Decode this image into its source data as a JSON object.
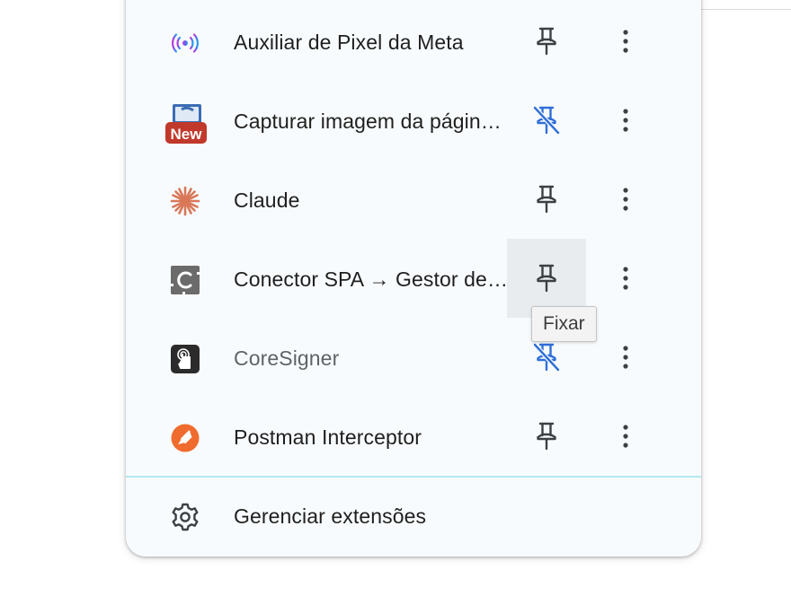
{
  "extensions": [
    {
      "name": "Auxiliar de Pixel da Meta",
      "icon": "meta-pixel-icon",
      "pinned": true
    },
    {
      "name": "Capturar imagem da página inteira",
      "icon": "screenshot-new-icon",
      "badge": "New",
      "pinned": false
    },
    {
      "name": "Claude",
      "icon": "claude-icon",
      "pinned": true
    },
    {
      "name": "Conector SPA → Gestor de Documentos",
      "icon": "connector-spa-icon",
      "pinned": true
    },
    {
      "name": "CoreSigner",
      "icon": "coresigner-icon",
      "pinned": false
    },
    {
      "name": "Postman Interceptor",
      "icon": "postman-icon",
      "pinned": true
    }
  ],
  "manage": {
    "label": "Gerenciar extensões",
    "icon": "gear-icon"
  },
  "tooltip": {
    "text": "Fixar"
  },
  "colors": {
    "panel_bg": "#f8fbfd",
    "divider": "#b3e9ef",
    "pin": "#3c4043",
    "unpinned_blue": "#2f6fd8",
    "claude": "#d97757",
    "postman": "#ef6c2e",
    "new_badge": "#c0392b"
  }
}
